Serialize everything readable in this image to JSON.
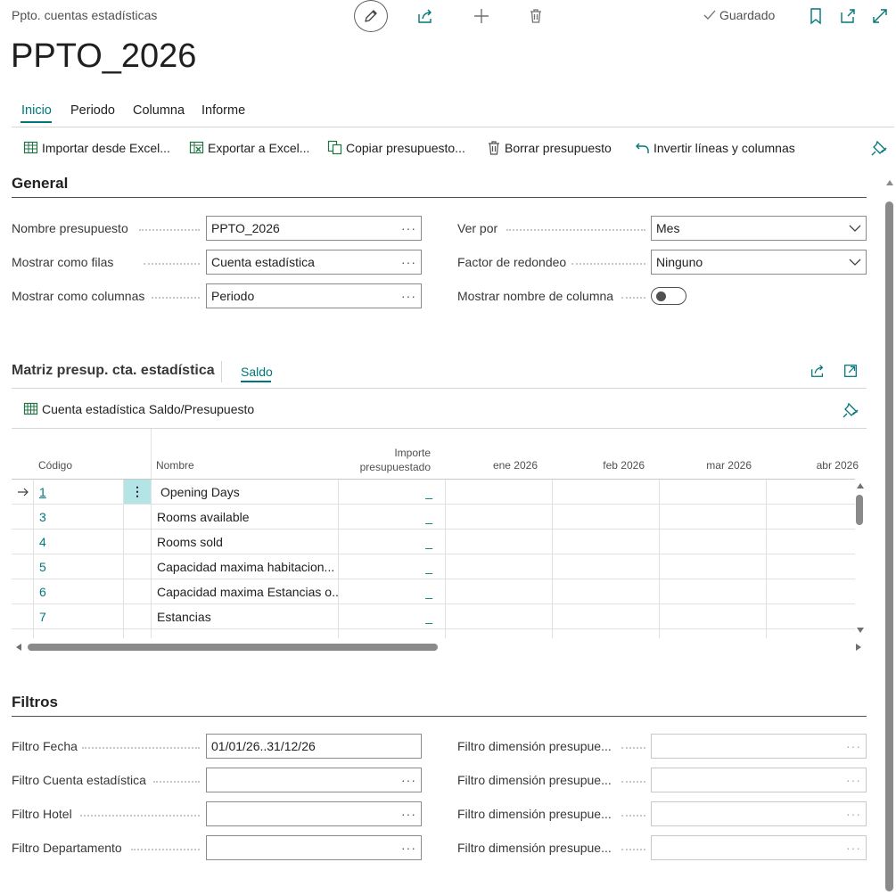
{
  "header": {
    "caption": "Ppto. cuentas estadísticas",
    "title": "PPTO_2026",
    "saved_label": "Guardado"
  },
  "tabs": [
    {
      "label": "Inicio",
      "active": true
    },
    {
      "label": "Periodo"
    },
    {
      "label": "Columna"
    },
    {
      "label": "Informe"
    }
  ],
  "actions": [
    {
      "label": "Importar desde Excel...",
      "icon": "excel-import-icon"
    },
    {
      "label": "Exportar a Excel...",
      "icon": "excel-export-icon"
    },
    {
      "label": "Copiar presupuesto...",
      "icon": "copy-icon"
    },
    {
      "label": "Borrar presupuesto",
      "icon": "delete-icon"
    },
    {
      "label": "Invertir líneas y columnas",
      "icon": "undo-icon"
    }
  ],
  "general": {
    "title": "General",
    "fields": {
      "budget_name": {
        "label": "Nombre presupuesto",
        "value": "PPTO_2026"
      },
      "show_rows": {
        "label": "Mostrar como filas",
        "value": "Cuenta estadística"
      },
      "show_cols": {
        "label": "Mostrar como columnas",
        "value": "Periodo"
      },
      "view_by": {
        "label": "Ver por",
        "value": "Mes"
      },
      "rounding": {
        "label": "Factor de redondeo",
        "value": "Ninguno"
      },
      "show_col_name": {
        "label": "Mostrar nombre de columna",
        "value": "off"
      }
    }
  },
  "matrix": {
    "title": "Matriz presup. cta. estadística",
    "tab": "Saldo",
    "subtitle": "Cuenta estadística Saldo/Presupuesto",
    "columns": {
      "code": "Código",
      "name": "Nombre",
      "amount_line1": "Importe",
      "amount_line2": "presupuestado",
      "months": [
        "ene 2026",
        "feb 2026",
        "mar 2026",
        "abr 2026"
      ]
    },
    "rows": [
      {
        "code": "1",
        "name": "Opening Days",
        "amount": "_"
      },
      {
        "code": "3",
        "name": "Rooms available",
        "amount": "_"
      },
      {
        "code": "4",
        "name": "Rooms sold",
        "amount": "_"
      },
      {
        "code": "5",
        "name": "Capacidad maxima habitacion...",
        "amount": "_"
      },
      {
        "code": "6",
        "name": "Capacidad maxima Estancias o...",
        "amount": "_"
      },
      {
        "code": "7",
        "name": "Estancias",
        "amount": "_"
      }
    ]
  },
  "filters": {
    "title": "Filtros",
    "date": {
      "label": "Filtro Fecha",
      "value": "01/01/26..31/12/26"
    },
    "stat_account": {
      "label": "Filtro Cuenta estadística",
      "value": ""
    },
    "hotel": {
      "label": "Filtro Hotel",
      "value": ""
    },
    "department": {
      "label": "Filtro Departamento",
      "value": ""
    },
    "dim_label": "Filtro dimensión presupue..."
  },
  "colors": {
    "accent": "#00777a",
    "selected_cell": "#b3e5e6"
  }
}
